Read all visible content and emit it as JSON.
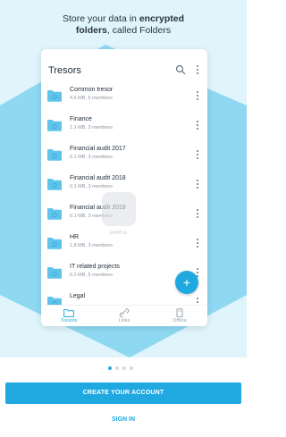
{
  "headline": {
    "line1_prefix": "Store your data in ",
    "line1_bold": "encrypted",
    "line2_bold": "folders",
    "line2_suffix": ", called Folders"
  },
  "app": {
    "title": "Tresors",
    "items": [
      {
        "name": "Common tresor",
        "meta": "4.5 MB, 5 members"
      },
      {
        "name": "Finance",
        "meta": "1.1 MB, 3 members"
      },
      {
        "name": "Financial audit 2017",
        "meta": "0.1 MB, 3 members"
      },
      {
        "name": "Financial audit 2018",
        "meta": "0.1 MB, 3 members"
      },
      {
        "name": "Financial audit 2019",
        "meta": "0.1 MB, 3 members"
      },
      {
        "name": "HR",
        "meta": "1.8 MB, 3 members"
      },
      {
        "name": "IT related projects",
        "meta": "0.2 MB, 5 members"
      },
      {
        "name": "Legal",
        "meta": ""
      }
    ],
    "fab_label": "+",
    "watermark_text": "SAMPLE",
    "nav": [
      {
        "label": "Tresors",
        "icon": "folder-icon",
        "active": true
      },
      {
        "label": "Links",
        "icon": "link-icon",
        "active": false
      },
      {
        "label": "Offline",
        "icon": "offline-icon",
        "active": false
      }
    ]
  },
  "pager": {
    "count": 4,
    "active_index": 0
  },
  "cta": {
    "create_account": "CREATE YOUR ACCOUNT",
    "sign_in": "SIGN IN"
  },
  "colors": {
    "accent": "#20a9e1",
    "hero_bg": "#dff4fb",
    "hero_shape": "#8fd8f2",
    "folder": "#5ec4ec"
  }
}
